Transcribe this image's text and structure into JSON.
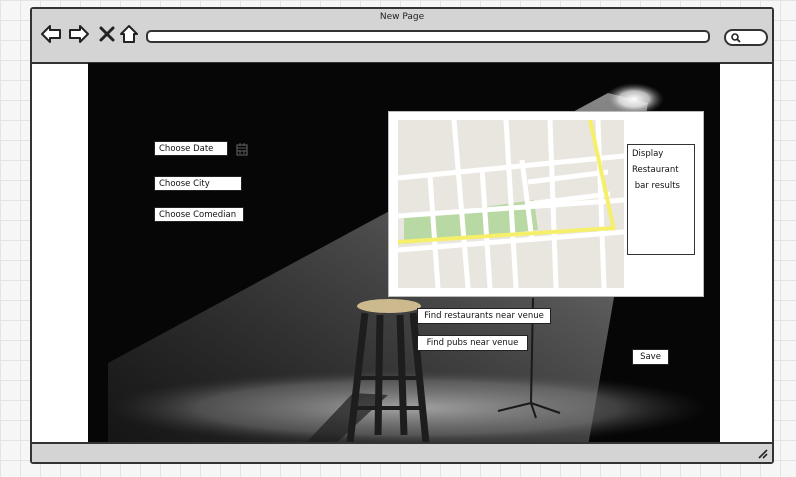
{
  "window": {
    "title": "New Page"
  },
  "nav": {
    "back_icon": "back-arrow-icon",
    "forward_icon": "forward-arrow-icon",
    "close_icon": "close-x-icon",
    "home_icon": "home-icon",
    "search_icon": "search-icon"
  },
  "form": {
    "date_label": "Choose Date",
    "date_icon": "calendar-icon",
    "city_label": "Choose City",
    "comedian_label": "Choose Comedian"
  },
  "map": {
    "results_lines": [
      "Display",
      "Restaurant",
      " bar results"
    ]
  },
  "actions": {
    "find_restaurants": "Find restaurants near venue",
    "find_pubs": "Find pubs near venue",
    "save": "Save"
  },
  "colors": {
    "map_road": "#ffffff",
    "map_block": "#e9e6df",
    "map_park": "#b9d9a4",
    "map_highway": "#f5ef6a"
  }
}
